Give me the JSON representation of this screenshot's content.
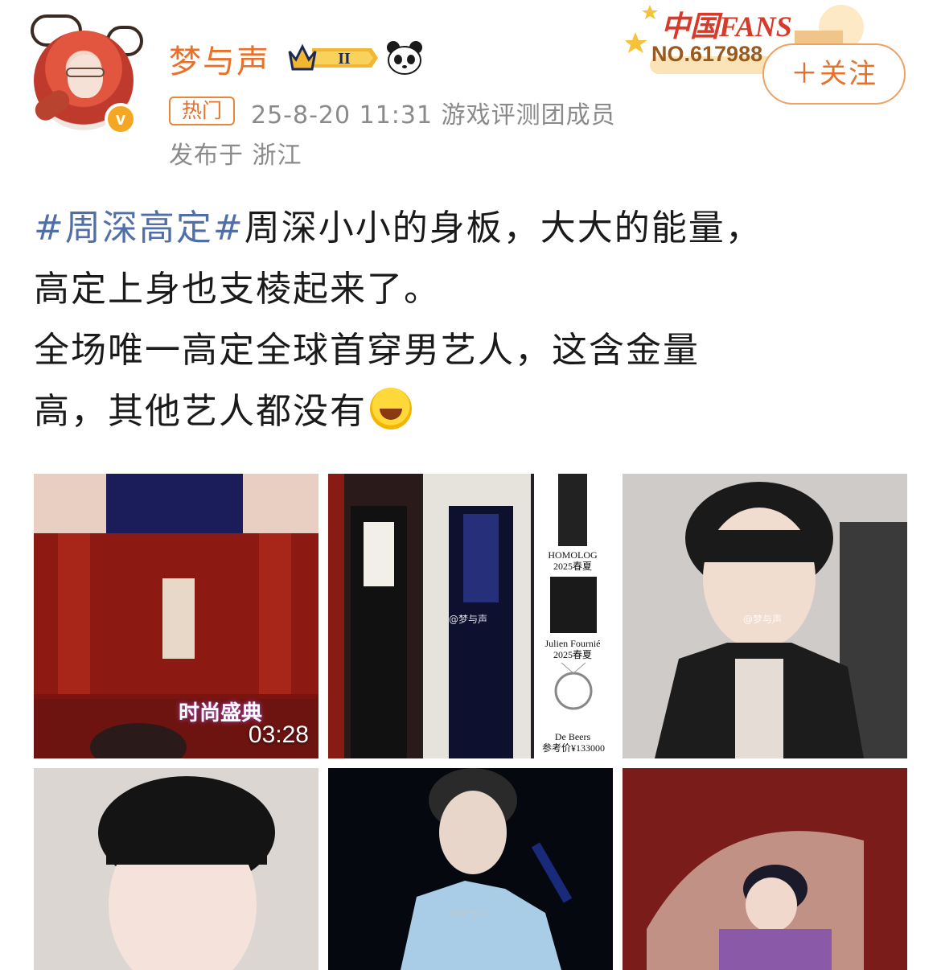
{
  "header": {
    "username": "梦与声",
    "level_badge": "II",
    "hot_tag": "热门",
    "meta": "25-8-20 11:31  游戏评测团成员",
    "location": "发布于 浙江",
    "fans_title": "中国FANS",
    "fans_number": "NO.617988",
    "follow_label": "＋关注"
  },
  "post": {
    "hashtag": "#周深高定#",
    "line1": "周深小小的身板，大大的能量，",
    "line2": "高定上身也支棱起来了。",
    "line3": "全场唯一高定全球首穿男艺人，这含金量",
    "line4": "高，其他艺人都没有"
  },
  "media": {
    "video_duration": "03:28",
    "video_overlay": "时尚盛典",
    "watermark": "@梦与声",
    "caption1_brand": "HOMOLOG",
    "caption1_season": "2025春夏",
    "caption2_brand": "Julien Fournié",
    "caption2_season": "2025春夏",
    "caption3_brand": "De Beers",
    "caption3_price": "参考价¥133000"
  },
  "icons": [
    "verified-v-icon",
    "crown-level-icon",
    "panda-icon",
    "laughing-emoji-icon"
  ],
  "colors": {
    "accent": "#e8702a",
    "hashtag": "#506fa8",
    "meta": "#8a8a8a"
  }
}
